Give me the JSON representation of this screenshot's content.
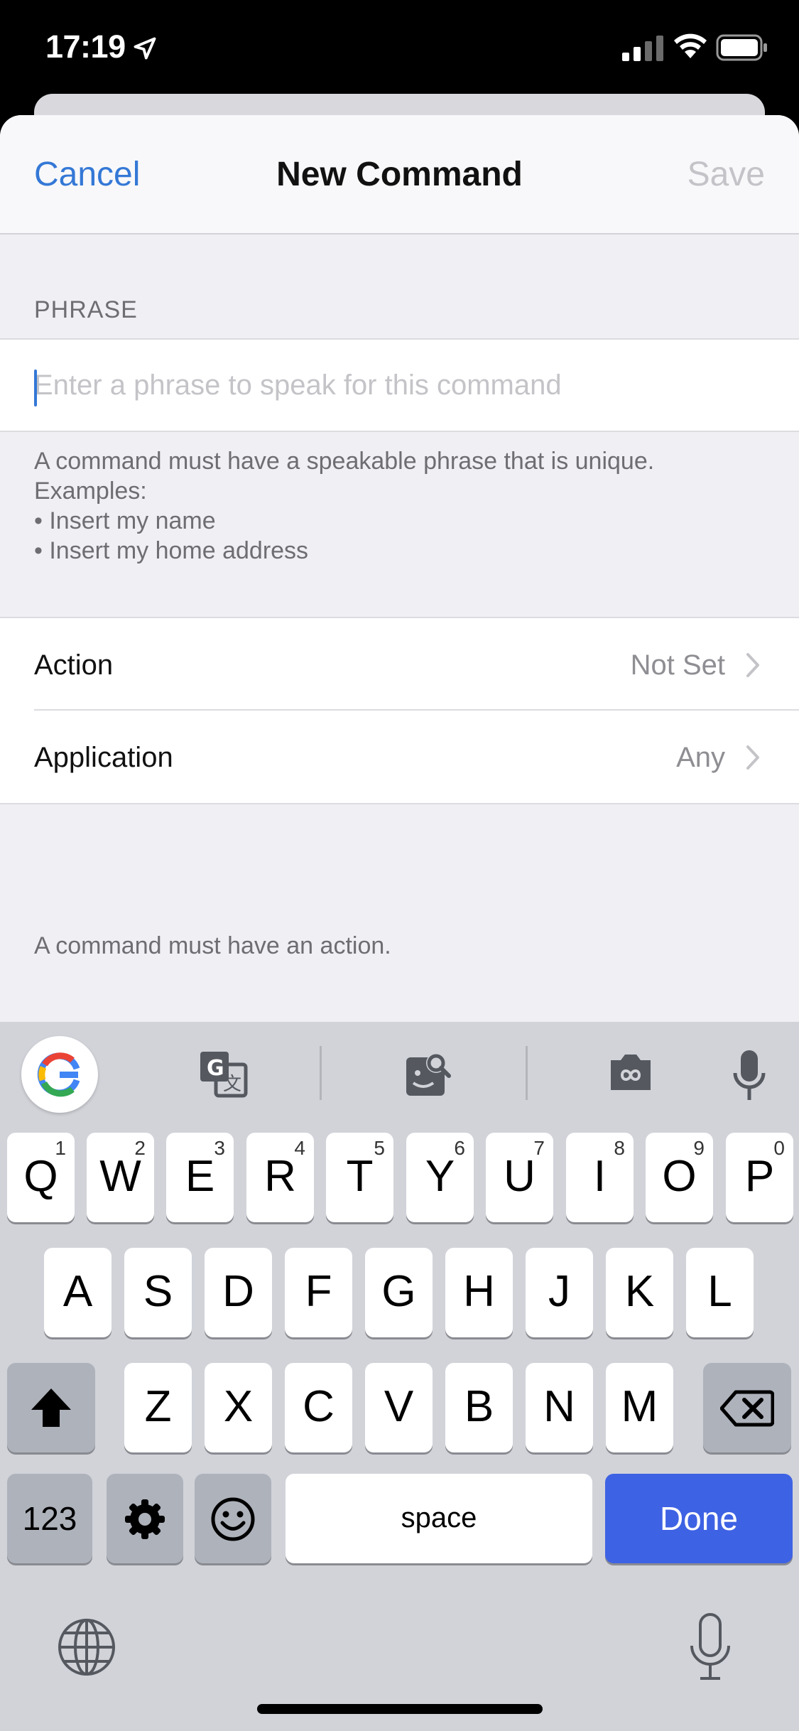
{
  "status_bar": {
    "time": "17:19",
    "icons": [
      "location-arrow-icon",
      "cellular-signal-icon",
      "wifi-icon",
      "battery-icon"
    ]
  },
  "nav": {
    "cancel_label": "Cancel",
    "title": "New Command",
    "save_label": "Save"
  },
  "phrase_section": {
    "header": "PHRASE",
    "input_value": "",
    "input_placeholder": "Enter a phrase to speak for this command",
    "footer_lines": [
      "A command must have a speakable phrase that is unique.",
      "Examples:",
      "• Insert my name",
      "• Insert my home address"
    ]
  },
  "options": {
    "rows": [
      {
        "label": "Action",
        "value": "Not Set"
      },
      {
        "label": "Application",
        "value": "Any"
      }
    ],
    "footer": "A command must have an action."
  },
  "keyboard": {
    "toolbar_icons": [
      "google-g-icon",
      "translate-icon",
      "image-search-icon",
      "gif-camera-icon",
      "voice-mic-icon"
    ],
    "rows": [
      [
        {
          "label": "Q",
          "hint": "1"
        },
        {
          "label": "W",
          "hint": "2"
        },
        {
          "label": "E",
          "hint": "3"
        },
        {
          "label": "R",
          "hint": "4"
        },
        {
          "label": "T",
          "hint": "5"
        },
        {
          "label": "Y",
          "hint": "6"
        },
        {
          "label": "U",
          "hint": "7"
        },
        {
          "label": "I",
          "hint": "8"
        },
        {
          "label": "O",
          "hint": "9"
        },
        {
          "label": "P",
          "hint": "0"
        }
      ],
      [
        {
          "label": "A"
        },
        {
          "label": "S"
        },
        {
          "label": "D"
        },
        {
          "label": "F"
        },
        {
          "label": "G"
        },
        {
          "label": "H"
        },
        {
          "label": "J"
        },
        {
          "label": "K"
        },
        {
          "label": "L"
        }
      ],
      [
        {
          "label": "Z"
        },
        {
          "label": "X"
        },
        {
          "label": "C"
        },
        {
          "label": "V"
        },
        {
          "label": "B"
        },
        {
          "label": "N"
        },
        {
          "label": "M"
        }
      ]
    ],
    "numbers_label": "123",
    "space_label": "space",
    "done_label": "Done",
    "colors": {
      "done": "#3e62e4",
      "background": "#d1d3d9"
    }
  },
  "colors": {
    "accent": "#3478d6",
    "disabled": "#c3c3c8"
  }
}
